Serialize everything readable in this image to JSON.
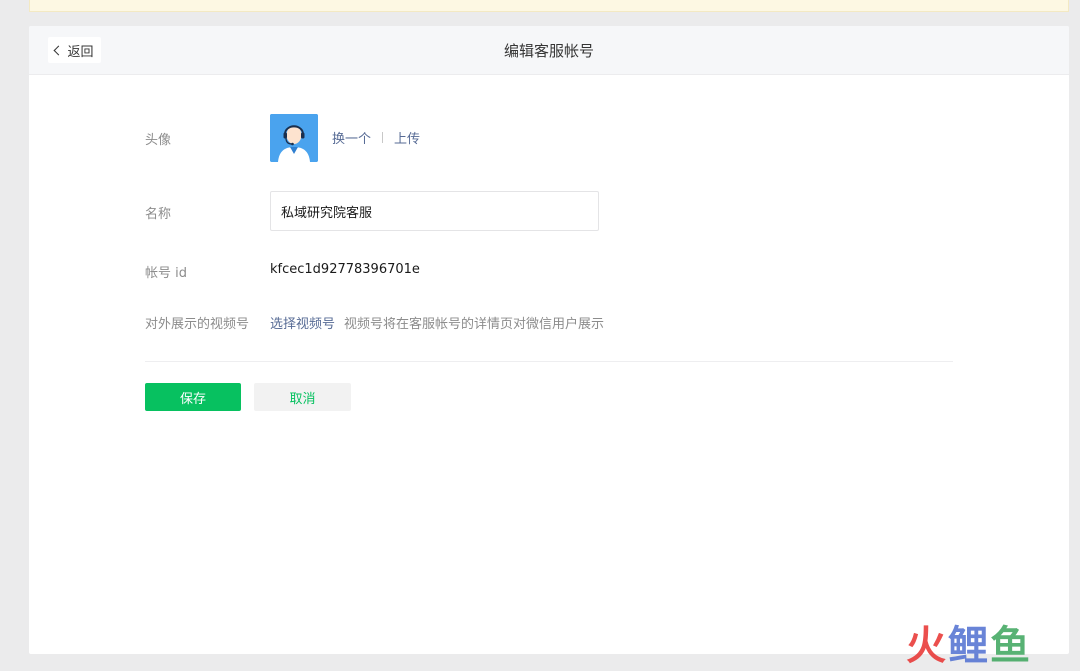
{
  "header": {
    "back_label": "返回",
    "title": "编辑客服帐号"
  },
  "form": {
    "avatar": {
      "label": "头像",
      "change_label": "换一个",
      "upload_label": "上传"
    },
    "name": {
      "label": "名称",
      "value": "私域研究院客服"
    },
    "account_id": {
      "label": "帐号 id",
      "value": "kfcec1d92778396701e"
    },
    "channel": {
      "label": "对外展示的视频号",
      "select_label": "选择视频号",
      "hint": "视频号将在客服帐号的详情页对微信用户展示"
    }
  },
  "actions": {
    "save_label": "保存",
    "cancel_label": "取消"
  },
  "watermark": {
    "char1": "火",
    "char2": "鲤",
    "char3": "鱼"
  },
  "colors": {
    "primary_green": "#07c160",
    "link_blue": "#576b95",
    "avatar_blue": "#4aa3ee"
  }
}
